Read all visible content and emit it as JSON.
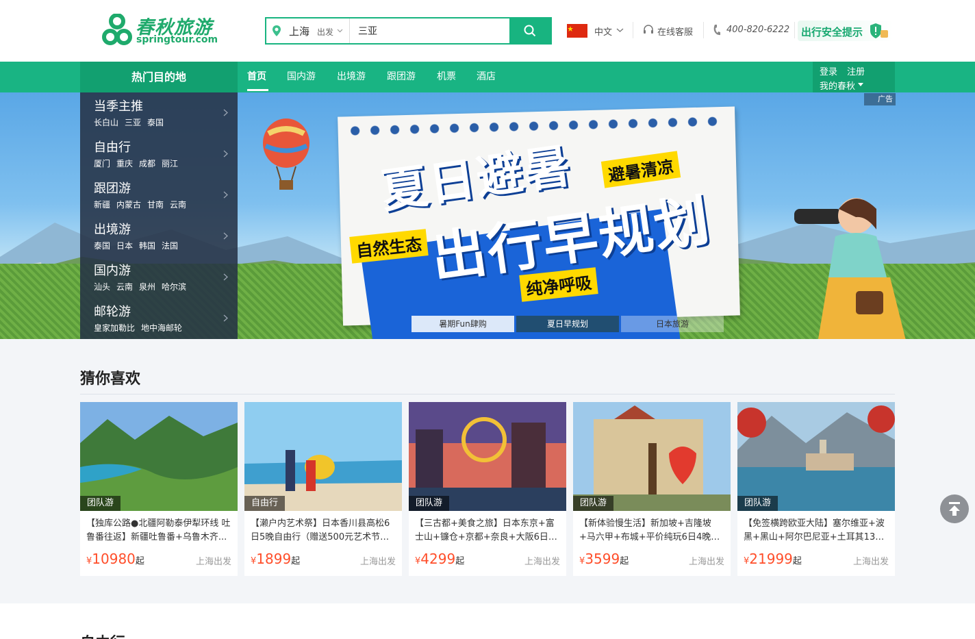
{
  "header": {
    "logo_cn": "春秋旅游",
    "logo_en": "springtour.com",
    "search": {
      "city": "上海",
      "depart_label": "出发",
      "query": "三亚"
    },
    "language": "中文",
    "customer_service": "在线客服",
    "phone": "400-820-6222",
    "safety_tip": "出行安全提示"
  },
  "nav": {
    "hot_destinations": "热门目的地",
    "items": [
      "首页",
      "国内游",
      "出境游",
      "跟团游",
      "机票",
      "酒店"
    ],
    "active": "首页",
    "login": "登录",
    "register": "注册",
    "my_account": "我的春秋"
  },
  "side_menu": [
    {
      "title": "当季主推",
      "subs": [
        "长白山",
        "三亚",
        "泰国"
      ]
    },
    {
      "title": "自由行",
      "subs": [
        "厦门",
        "重庆",
        "成都",
        "丽江"
      ]
    },
    {
      "title": "跟团游",
      "subs": [
        "新疆",
        "内蒙古",
        "甘南",
        "云南"
      ]
    },
    {
      "title": "出境游",
      "subs": [
        "泰国",
        "日本",
        "韩国",
        "法国"
      ]
    },
    {
      "title": "国内游",
      "subs": [
        "汕头",
        "云南",
        "泉州",
        "哈尔滨"
      ]
    },
    {
      "title": "邮轮游",
      "subs": [
        "皇家加勒比",
        "地中海邮轮"
      ]
    }
  ],
  "banner": {
    "ad_label": "广告",
    "headline_1": "夏日避暑",
    "headline_2": "出行早规划",
    "tag_1": "避暑清凉",
    "tag_2": "自然生态",
    "tag_3": "纯净呼吸",
    "tabs": [
      "暑期Fun肆购",
      "夏日早规划",
      "日本旅游"
    ]
  },
  "recommend": {
    "title": "猜你喜欢",
    "price_suffix": "起",
    "currency": "¥",
    "items": [
      {
        "badge": "团队游",
        "desc": "【独库公路●北疆阿勒泰伊犁环线 吐鲁番往返】新疆吐鲁番+乌鲁木齐...",
        "price": "10980",
        "from": "上海出发"
      },
      {
        "badge": "自由行",
        "desc": "【濑户内艺术祭】日本香川县高松6日5晚自由行（赠送500元艺术节礼...",
        "price": "1899",
        "from": "上海出发"
      },
      {
        "badge": "团队游",
        "desc": "【三古都+美食之旅】日本东京+富士山+镰仓+京都+奈良+大阪6日5...",
        "price": "4299",
        "from": "上海出发"
      },
      {
        "badge": "团队游",
        "desc": "【新体验慢生活】新加坡+吉隆坡+马六甲+布城+平价纯玩6日4晚跟...",
        "price": "3599",
        "from": "上海出发"
      },
      {
        "badge": "团队游",
        "desc": "【免签横跨欧亚大陆】塞尔维亚+波黑+黑山+阿尔巴尼亚+土耳其13日...",
        "price": "21999",
        "from": "上海出发"
      }
    ]
  },
  "next_section_title": "自由行",
  "colors": {
    "brand_green": "#19b483",
    "price_red": "#ff4e2a"
  }
}
